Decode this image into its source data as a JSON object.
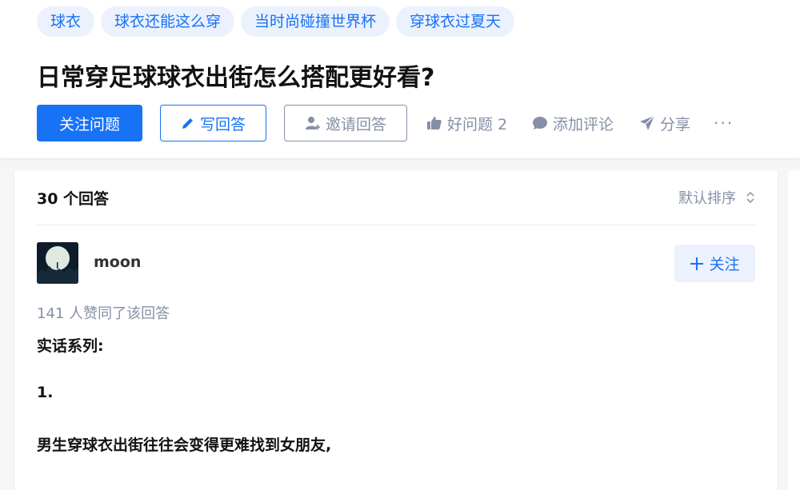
{
  "tags": [
    "球衣",
    "球衣还能这么穿",
    "当时尚碰撞世界杯",
    "穿球衣过夏天"
  ],
  "question": {
    "title": "日常穿足球球衣出街怎么搭配更好看?"
  },
  "actions": {
    "follow_question": "关注问题",
    "write_answer": "写回答",
    "invite_answer": "邀请回答",
    "good_question": "好问题 2",
    "add_comment": "添加评论",
    "share": "分享",
    "more": "···"
  },
  "answers": {
    "count_label": "30 个回答",
    "sort_label": "默认排序"
  },
  "answer": {
    "author": "moon",
    "follow_label": "关注",
    "upvote_text": "141 人赞同了该回答",
    "paragraphs": [
      "实话系列:",
      "1.",
      "男生穿球衣出街往往会变得更难找到女朋友,"
    ]
  },
  "colors": {
    "brand": "#1772f6",
    "muted": "#8590a6",
    "tag_bg": "#ebf1fd"
  },
  "icons": [
    "pencil-icon",
    "invite-user-icon",
    "thumbs-up-icon",
    "comment-bubble-icon",
    "paper-plane-icon",
    "more-icon",
    "sort-icon",
    "plus-icon"
  ]
}
